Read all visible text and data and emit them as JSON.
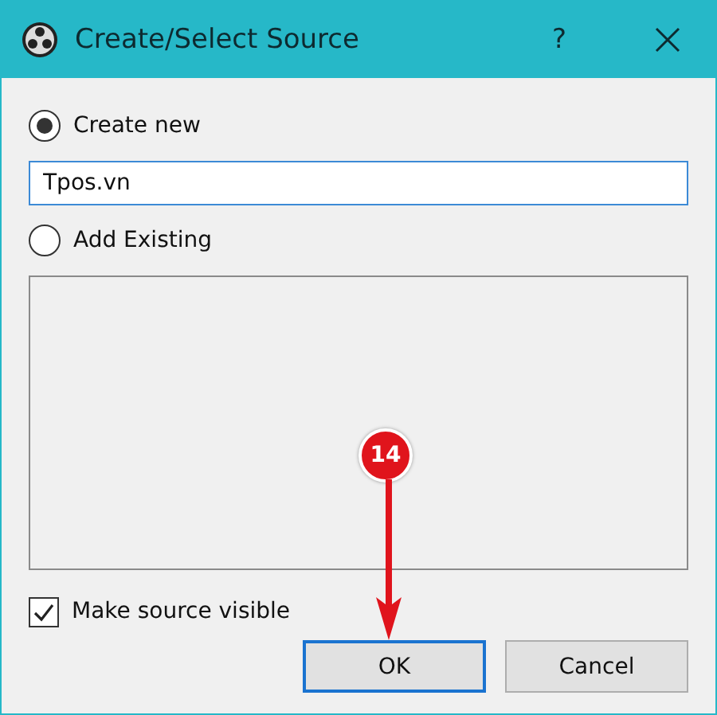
{
  "window": {
    "title": "Create/Select Source",
    "help_button": "?"
  },
  "options": [
    {
      "label": "Create new",
      "selected": true
    },
    {
      "label": "Add Existing",
      "selected": false
    }
  ],
  "name_field": {
    "value": "Tpos.vn"
  },
  "visible_checkbox": {
    "label": "Make source visible",
    "checked": true
  },
  "buttons": [
    {
      "label": "OK",
      "default": true
    },
    {
      "label": "Cancel",
      "default": false
    }
  ],
  "annotation": {
    "step": "14"
  }
}
